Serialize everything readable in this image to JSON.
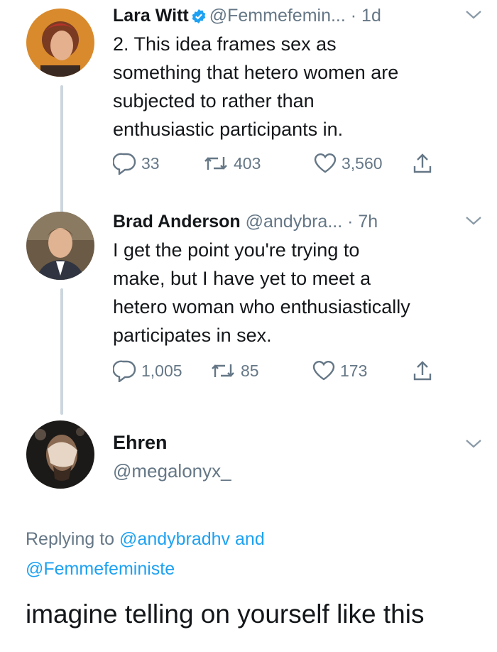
{
  "tweets": [
    {
      "name": "Lara Witt",
      "handle": "@Femmefemin...",
      "time": "· 1d",
      "lines": [
        "2. This idea frames sex as",
        "something that hetero women are",
        "subjected to rather than",
        "enthusiastic participants in."
      ],
      "replies": "33",
      "retweets": "403",
      "likes": "3,560"
    },
    {
      "name": "Brad Anderson",
      "handle": "@andybra...",
      "time": "· 7h",
      "lines": [
        "I get the point you're trying to",
        "make, but I have yet to meet a",
        "hetero woman who enthusiastically",
        "participates in sex."
      ],
      "replies": "1,005",
      "retweets": "85",
      "likes": "173"
    }
  ],
  "reply": {
    "name": "Ehren",
    "handle": "@megalonyx_",
    "replying_prefix": "Replying to",
    "replying_user1": "@andybradhv",
    "replying_and": "and",
    "replying_user2": "@Femmefeministe",
    "text": "imagine telling on yourself like this"
  },
  "colors": {
    "link": "#1da1f2",
    "muted": "#657786",
    "verified": "#1da1f2",
    "thread_line": "#cbd6de"
  }
}
